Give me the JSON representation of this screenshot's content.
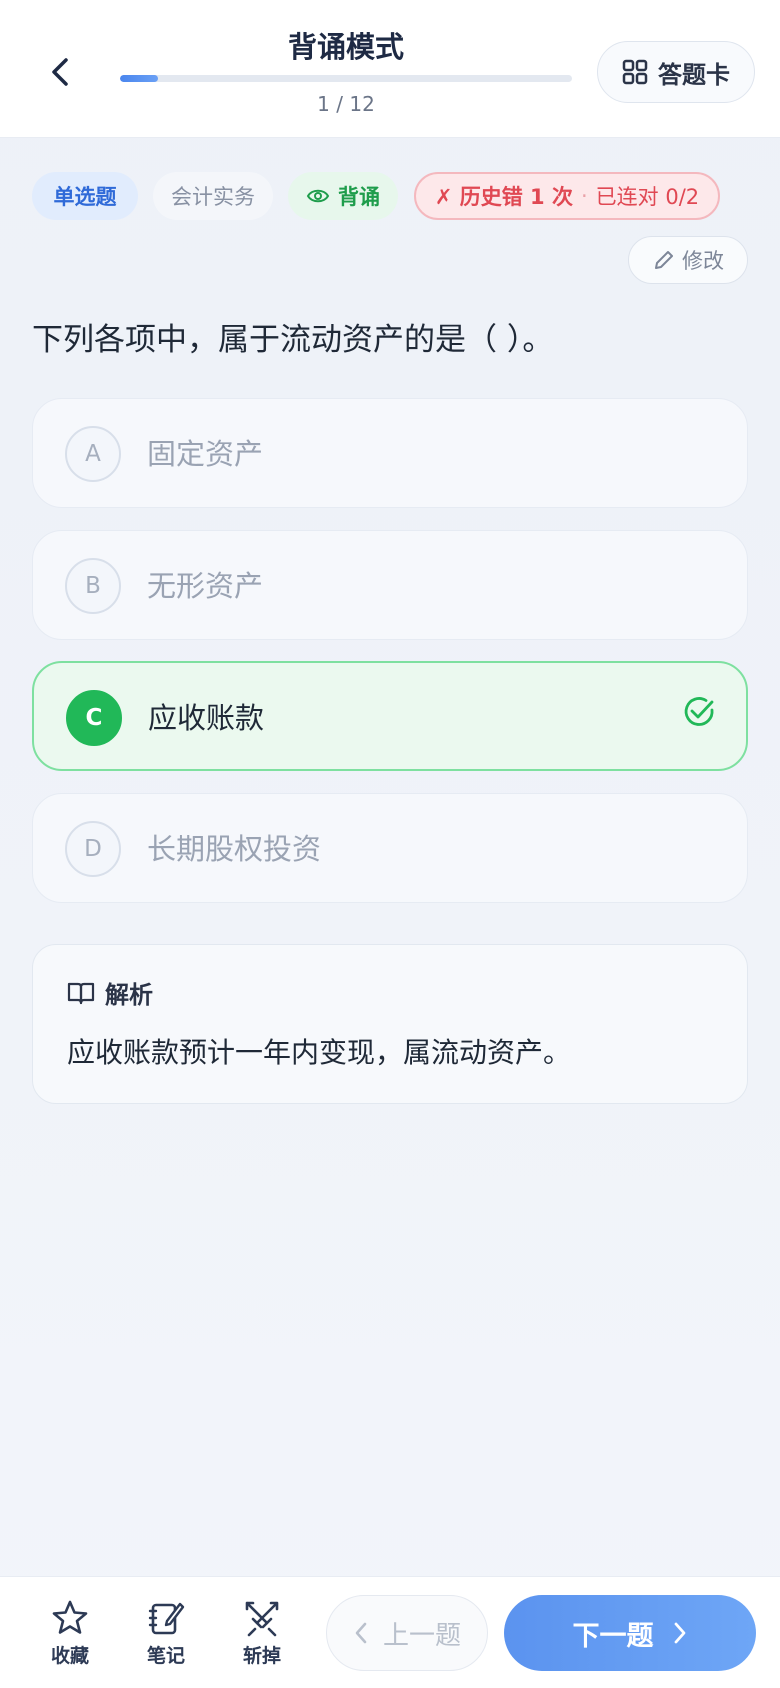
{
  "header": {
    "title": "背诵模式",
    "progress_text": "1 / 12",
    "progress_fraction": 0.083,
    "answer_card_label": "答题卡"
  },
  "tags": {
    "type": "单选题",
    "subject": "会计实务",
    "mode": "背诵",
    "history_wrong": "✗ 历史错 1 次",
    "history_sep": "·",
    "history_streak": "已连对 0/2"
  },
  "edit_label": "修改",
  "question": "下列各项中，属于流动资产的是（ ）。",
  "options": [
    {
      "letter": "A",
      "text": "固定资产"
    },
    {
      "letter": "B",
      "text": "无形资产"
    },
    {
      "letter": "C",
      "text": "应收账款",
      "correct": true
    },
    {
      "letter": "D",
      "text": "长期股权投资"
    }
  ],
  "analysis": {
    "title": "解析",
    "body": "应收账款预计一年内变现，属流动资产。"
  },
  "bottom": {
    "favorite": "收藏",
    "notes": "笔记",
    "cut": "斩掉",
    "prev": "上一题",
    "next": "下一题"
  },
  "colors": {
    "accent_blue": "#4a86ee",
    "correct_green": "#21b858",
    "error_red": "#e04853"
  }
}
